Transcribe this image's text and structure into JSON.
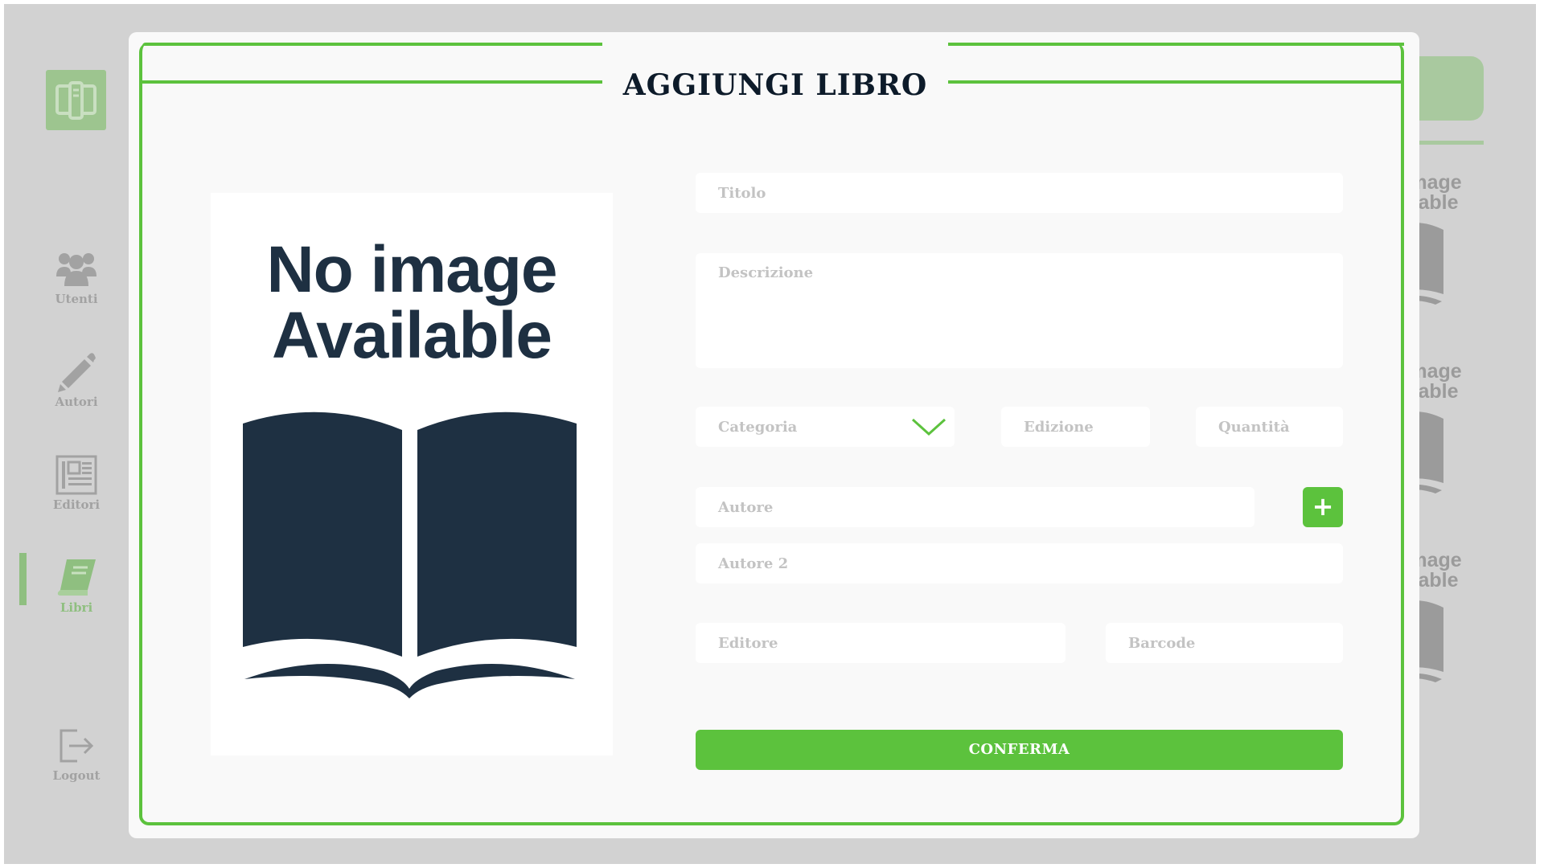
{
  "sidebar": {
    "logo_icon": "tablet-book-icon",
    "items": [
      {
        "label": "Utenti",
        "icon": "users-icon",
        "active": false
      },
      {
        "label": "Autori",
        "icon": "pencil-icon",
        "active": false
      },
      {
        "label": "Editori",
        "icon": "newspaper-icon",
        "active": false
      },
      {
        "label": "Libri",
        "icon": "book-icon",
        "active": true
      }
    ],
    "logout": {
      "label": "Logout",
      "icon": "logout-icon"
    }
  },
  "background": {
    "card_text_line1": "mage",
    "card_text_line2": "lable"
  },
  "modal": {
    "title": "AGGIUNGI LIBRO",
    "cover": {
      "line1": "No image",
      "line2": "Available"
    },
    "fields": {
      "titolo": "Titolo",
      "descrizione": "Descrizione",
      "categoria": "Categoria",
      "edizione": "Edizione",
      "quantita": "Quantità",
      "autore": "Autore",
      "autore2": "Autore 2",
      "editore": "Editore",
      "barcode": "Barcode"
    },
    "add_author": "+",
    "confirm": "CONFERMA"
  },
  "colors": {
    "accent": "#5cc23d",
    "title": "#0d1b2a",
    "cover_art": "#1e3042",
    "placeholder": "#c3c3c3",
    "backdrop": "#d2d2d2"
  }
}
